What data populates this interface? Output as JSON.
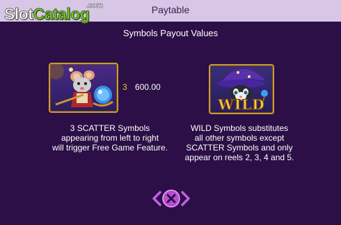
{
  "header": {
    "title": "Paytable"
  },
  "logo": {
    "slot": "Slot",
    "catalog": "Catalog",
    "com": ".com"
  },
  "section": {
    "title": "Symbols Payout Values"
  },
  "symbols": [
    {
      "name": "scatter",
      "pays": [
        {
          "count": "3",
          "value": "600.00"
        }
      ],
      "description": [
        "3 SCATTER Symbols",
        "appearing from left to right",
        "will trigger Free Game Feature."
      ]
    },
    {
      "name": "wild",
      "label": "WILD",
      "description": [
        "WILD Symbols substitutes",
        "all other symbols except",
        "SCATTER Symbols and only",
        "appear on reels 2, 3, 4 and 5."
      ]
    }
  ],
  "colors": {
    "background": "#2c0f46",
    "header": "#d8c6e6",
    "pay_count": "#f3c431",
    "frame_gold": "#c79a3a",
    "close_button": "#b94bd6"
  },
  "icons": {
    "close": "close-x-icon",
    "prev": "chevron-left-icon",
    "next": "chevron-right-icon"
  }
}
